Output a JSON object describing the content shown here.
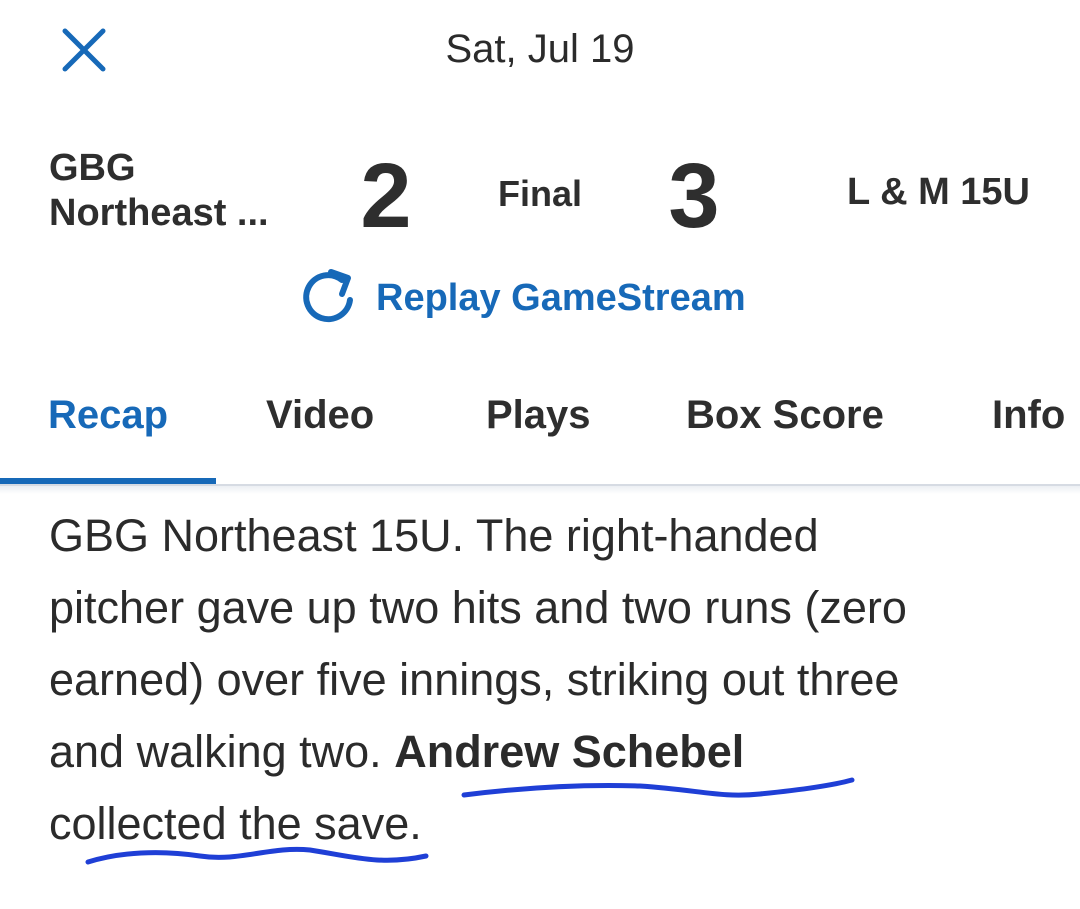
{
  "header": {
    "close_icon": "close-icon",
    "date": "Sat, Jul 19"
  },
  "game": {
    "home_team": "GBG Northeast ...",
    "home_score": "2",
    "status": "Final",
    "away_score": "3",
    "away_team": "L & M 15U"
  },
  "replay": {
    "icon": "refresh-icon",
    "label": "Replay GameStream"
  },
  "tabs": [
    {
      "label": "Recap",
      "active": true
    },
    {
      "label": "Video"
    },
    {
      "label": "Plays"
    },
    {
      "label": "Box Score"
    },
    {
      "label": "Info"
    }
  ],
  "recap": {
    "line1": "GBG Northeast 15U. The right-handed",
    "line2": "pitcher gave up two hits and two runs (zero",
    "line3": "earned) over five innings, striking out three",
    "line4_text": "and walking two. ",
    "line4_name": "Andrew Schebel",
    "line5": "collected the save."
  },
  "colors": {
    "accent": "#1769b8",
    "text": "#2e2e2e",
    "annotation": "#1f3fd6"
  }
}
